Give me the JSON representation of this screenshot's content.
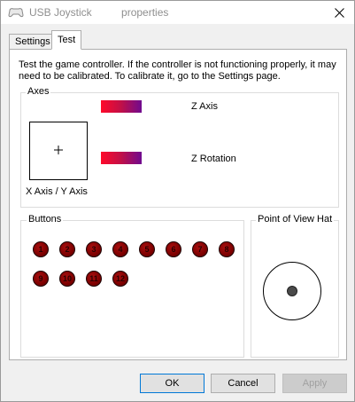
{
  "window": {
    "title": "USB Joystick          properties",
    "close_icon": "close-icon"
  },
  "tabs": [
    {
      "label": "Settings",
      "selected": false
    },
    {
      "label": "Test",
      "selected": true
    }
  ],
  "test_page": {
    "description": "Test the game controller.  If the controller is not functioning properly, it may need to be calibrated.  To calibrate it, go to the Settings page.",
    "axes": {
      "group_label": "Axes",
      "xy_label": "X Axis / Y Axis",
      "z_axis_label": "Z Axis",
      "z_rotation_label": "Z Rotation",
      "bar_colors": [
        "#ff0a2a",
        "#700a8f"
      ]
    },
    "buttons": {
      "group_label": "Buttons",
      "items": [
        "1",
        "2",
        "3",
        "4",
        "5",
        "6",
        "7",
        "8",
        "9",
        "10",
        "11",
        "12"
      ],
      "indicator_color": "#7e0000"
    },
    "pov": {
      "group_label": "Point of View Hat"
    }
  },
  "footer": {
    "ok": "OK",
    "cancel": "Cancel",
    "apply": "Apply"
  }
}
